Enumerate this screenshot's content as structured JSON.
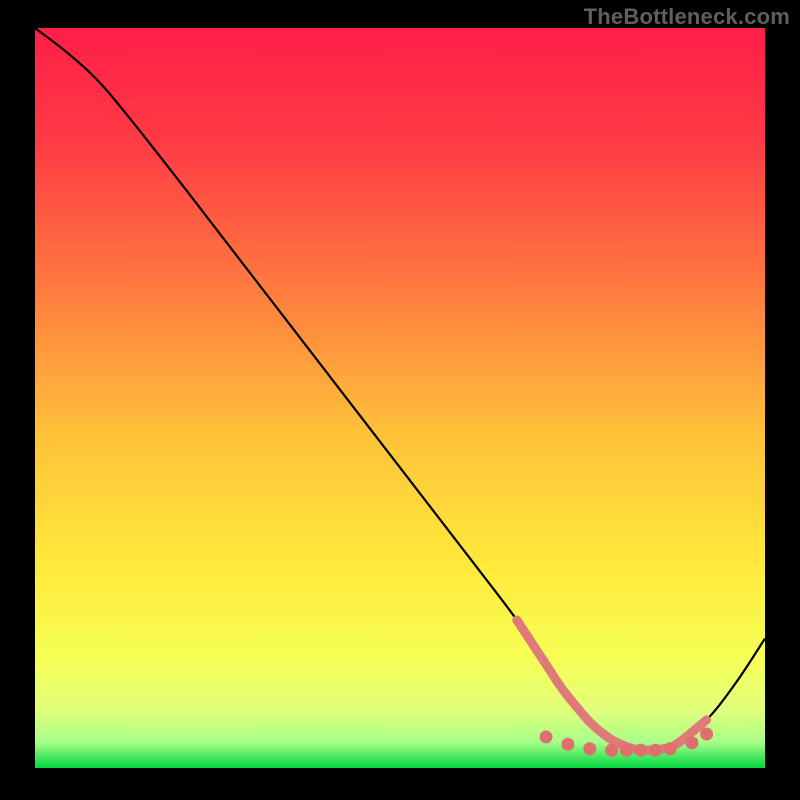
{
  "watermark": "TheBottleneck.com",
  "chart_data": {
    "type": "line",
    "title": "",
    "xlabel": "",
    "ylabel": "",
    "xlim": [
      0,
      100
    ],
    "ylim": [
      0,
      100
    ],
    "grid": false,
    "series": [
      {
        "name": "curve",
        "x": [
          0,
          4,
          8,
          12,
          20,
          30,
          40,
          50,
          60,
          66,
          70,
          72,
          74,
          76,
          78,
          80,
          82,
          84,
          86,
          88,
          92,
          96,
          100
        ],
        "y": [
          100,
          97,
          93.5,
          89,
          79,
          66.2,
          53.4,
          40.6,
          27.8,
          20,
          14,
          11,
          8.5,
          6.2,
          4.5,
          3.3,
          2.6,
          2.4,
          2.6,
          3.3,
          6.5,
          11.5,
          17.5
        ]
      },
      {
        "name": "highlight-band",
        "x": [
          66,
          70,
          72,
          74,
          76,
          78,
          80,
          82,
          84,
          86,
          88,
          92
        ],
        "y": [
          20,
          14,
          11,
          8.5,
          6.2,
          4.5,
          3.3,
          2.6,
          2.4,
          2.6,
          3.3,
          6.5
        ]
      }
    ],
    "highlight_dots": {
      "x": [
        70,
        73,
        76,
        79,
        81,
        83,
        85,
        87,
        90,
        92
      ],
      "y": [
        4.2,
        3.2,
        2.6,
        2.4,
        2.4,
        2.4,
        2.4,
        2.6,
        3.4,
        4.6
      ]
    },
    "gradient_stops": [
      {
        "offset": 0.0,
        "color": "#ff1f47"
      },
      {
        "offset": 0.15,
        "color": "#ff3a45"
      },
      {
        "offset": 0.35,
        "color": "#ff7a3f"
      },
      {
        "offset": 0.55,
        "color": "#ffc23a"
      },
      {
        "offset": 0.72,
        "color": "#ffe83a"
      },
      {
        "offset": 0.85,
        "color": "#f7ff55"
      },
      {
        "offset": 0.92,
        "color": "#e2ff7a"
      },
      {
        "offset": 0.965,
        "color": "#a8ff8a"
      },
      {
        "offset": 1.0,
        "color": "#00d63e"
      }
    ],
    "colors": {
      "curve": "#000000",
      "highlight": "#e07979",
      "dot": "#df6f6f"
    }
  }
}
